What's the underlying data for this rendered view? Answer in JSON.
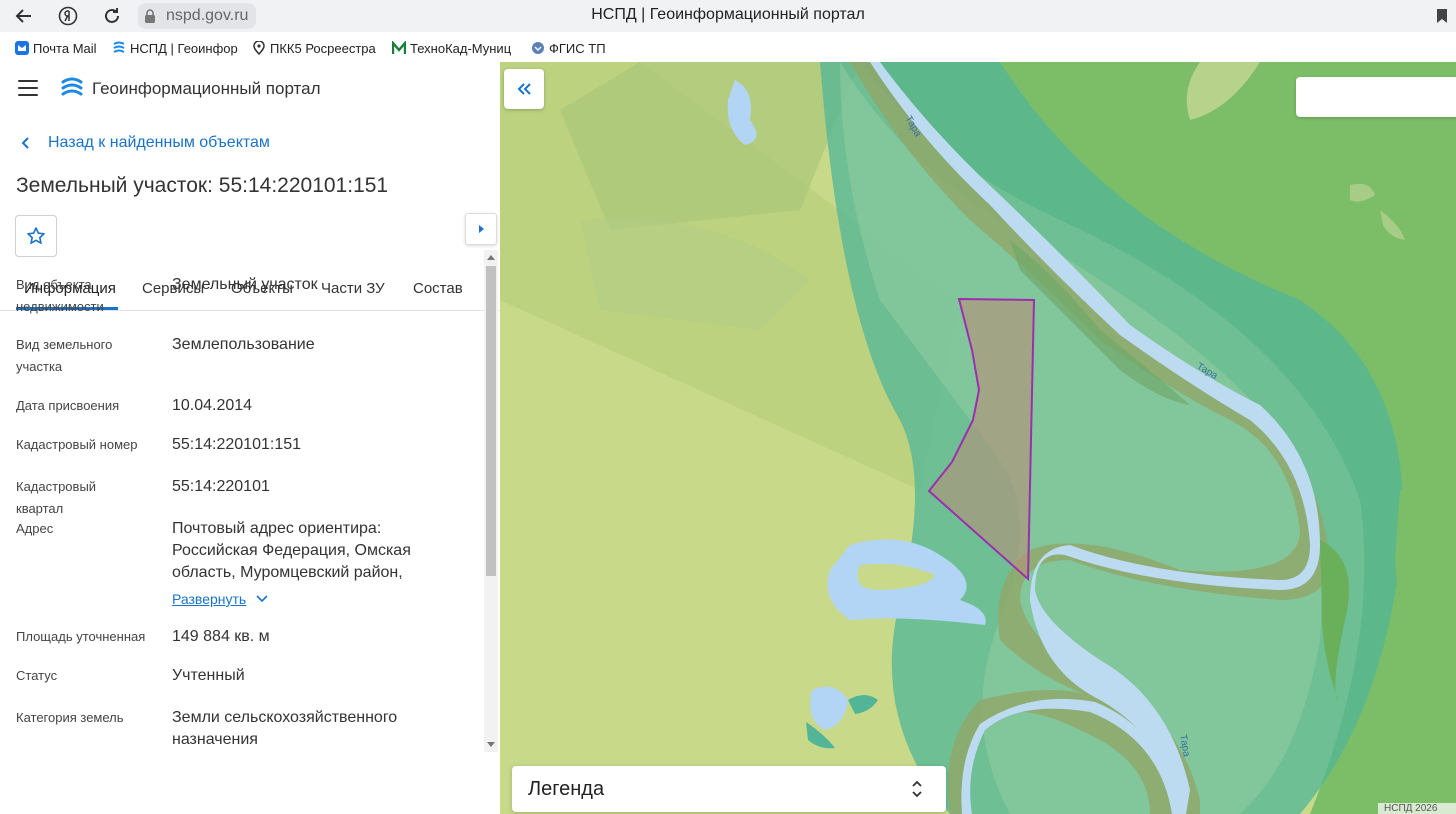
{
  "browser": {
    "address": "nspd.gov.ru",
    "tab_title": "НСПД | Геоинформационный портал",
    "bookmarks": [
      {
        "label": "Почта Mail",
        "icon": "mail-icon"
      },
      {
        "label": "НСПД | Геоинфор",
        "icon": "nspd-icon"
      },
      {
        "label": "ПКК5 Росреестра",
        "icon": "pin-icon"
      },
      {
        "label": "ТехноКад-Муниц",
        "icon": "technokad-icon"
      },
      {
        "label": "ФГИС ТП",
        "icon": "fgis-icon"
      }
    ]
  },
  "app": {
    "title": "Геоинформационный портал",
    "back_link": "Назад к найденным объектам",
    "object_title": "Земельный участок: 55:14:220101:151"
  },
  "tabs": [
    {
      "label": "Информация",
      "active": true
    },
    {
      "label": "Сервисы",
      "active": false
    },
    {
      "label": "Объекты",
      "active": false
    },
    {
      "label": "Части ЗУ",
      "active": false
    },
    {
      "label": "Состав",
      "active": false
    }
  ],
  "info_rows": [
    {
      "label": "Вид объекта недвижимости",
      "value": "Земельный участок"
    },
    {
      "label": "Вид земельного участка",
      "value": "Землепользование"
    },
    {
      "label": "Дата присвоения",
      "value": "10.04.2014"
    },
    {
      "label": "Кадастровый номер",
      "value": "55:14:220101:151"
    },
    {
      "label": "Кадастровый квартал",
      "value": "55:14:220101"
    },
    {
      "label": "Адрес",
      "value": "Почтовый адрес ориентира: Российская Федерация, Омская область, Муромцевский район,",
      "expand_label": "Развернуть"
    },
    {
      "label": "Площадь уточненная",
      "value": "149 884 кв. м"
    },
    {
      "label": "Статус",
      "value": "Учтенный"
    },
    {
      "label": "Категория земель",
      "value": "Земли сельскохозяйственного назначения"
    }
  ],
  "map": {
    "river_labels": [
      "Тара",
      "Тара",
      "Тара"
    ],
    "legend_label": "Легенда",
    "copyright": "НСПД 2026",
    "parcel_outline_color": "#9b2fae"
  }
}
